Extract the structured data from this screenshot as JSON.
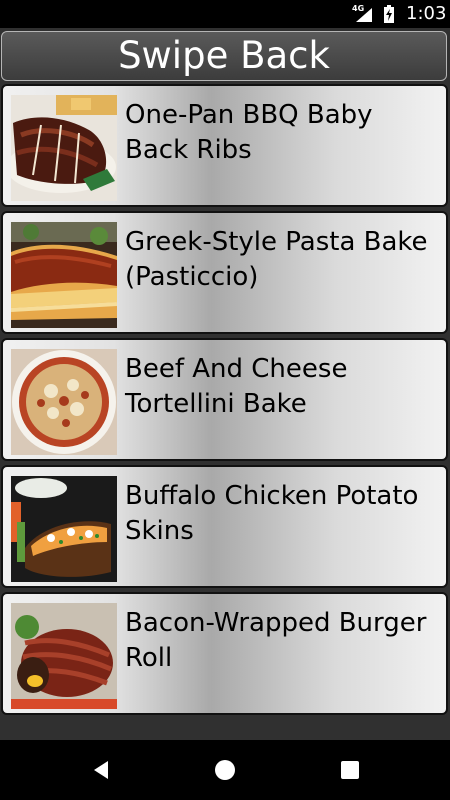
{
  "status_bar": {
    "network": "4G",
    "time": "1:03"
  },
  "header": {
    "title": "Swipe Back"
  },
  "recipes": [
    {
      "title": "One-Pan BBQ Baby Back Ribs",
      "image": "bbq-ribs-photo"
    },
    {
      "title": "Greek-Style Pasta Bake (Pasticcio)",
      "image": "pasta-bake-photo"
    },
    {
      "title": "Beef And Cheese Tortellini Bake",
      "image": "tortellini-bake-photo"
    },
    {
      "title": "Buffalo Chicken Potato Skins",
      "image": "potato-skins-photo"
    },
    {
      "title": "Bacon-Wrapped Burger Roll",
      "image": "burger-roll-photo"
    }
  ],
  "nav_bar": {
    "buttons": [
      "back-icon",
      "home-icon",
      "recents-icon"
    ]
  }
}
